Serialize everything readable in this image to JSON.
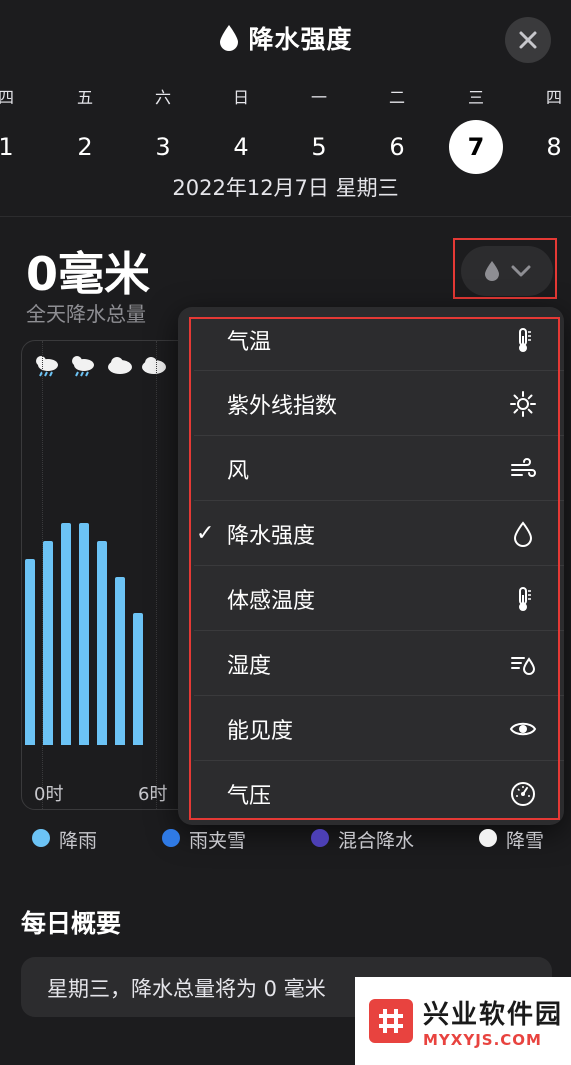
{
  "header": {
    "title": "降水强度",
    "weekdays": [
      "四",
      "五",
      "六",
      "日",
      "一",
      "二",
      "三",
      "四"
    ],
    "days": [
      "1",
      "2",
      "3",
      "4",
      "5",
      "6",
      "7",
      "8"
    ],
    "selected_day": "7",
    "date_line": "2022年12月7日 星期三"
  },
  "summary_top": {
    "amount": "0毫米",
    "amount_caption": "全天降水总量"
  },
  "chart": {
    "x_labels": [
      "0时",
      "6时"
    ],
    "weather_icons": [
      "cloud-sun-rain-icon",
      "cloud-sun-rain-icon",
      "cloud-icon",
      "cloud-icon"
    ]
  },
  "chart_data": {
    "type": "bar",
    "values": [
      0.62,
      0.68,
      0.74,
      0.74,
      0.68,
      0.56,
      0.44
    ],
    "x_labels": [
      "0时",
      "6时"
    ],
    "colors": {
      "rain": "#6cc3f5"
    }
  },
  "metric_menu": {
    "items": [
      {
        "label": "气温",
        "icon": "thermometer-icon",
        "checked": false
      },
      {
        "label": "紫外线指数",
        "icon": "sun-icon",
        "checked": false
      },
      {
        "label": "风",
        "icon": "wind-icon",
        "checked": false
      },
      {
        "label": "降水强度",
        "icon": "raindrop-icon",
        "checked": true
      },
      {
        "label": "体感温度",
        "icon": "thermometer-icon",
        "checked": false
      },
      {
        "label": "湿度",
        "icon": "humidity-icon",
        "checked": false
      },
      {
        "label": "能见度",
        "icon": "eye-icon",
        "checked": false
      },
      {
        "label": "气压",
        "icon": "gauge-icon",
        "checked": false
      }
    ],
    "check_mark": "✓"
  },
  "legend": [
    {
      "label": "降雨",
      "color": "#6cc3f5"
    },
    {
      "label": "雨夹雪",
      "color": "#2f7ae5"
    },
    {
      "label": "混合降水",
      "color": "#4c3fb5"
    },
    {
      "label": "降雪",
      "color": "#f2f2f2"
    }
  ],
  "daily_summary": {
    "title": "每日概要",
    "text": "星期三，降水总量将为 0 毫米"
  },
  "watermark": {
    "cn": "兴业软件园",
    "en": "MYXYJS.COM"
  }
}
